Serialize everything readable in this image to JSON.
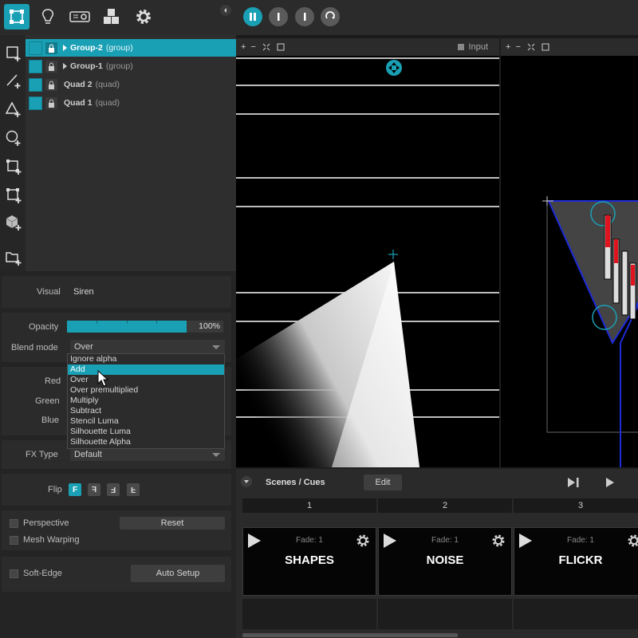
{
  "topbar": {
    "tools": [
      {
        "icon": "surface-tool-icon",
        "active": true
      },
      {
        "icon": "lightbulb-icon",
        "active": false
      },
      {
        "icon": "projector-icon",
        "active": false
      },
      {
        "icon": "cubes-icon",
        "active": false
      },
      {
        "icon": "gear-icon",
        "active": false
      }
    ],
    "transport": [
      {
        "icon": "pause-icon",
        "active": true
      },
      {
        "icon": "stop-icon",
        "active": false
      },
      {
        "icon": "stop-icon",
        "active": false
      },
      {
        "icon": "loop-icon",
        "active": false
      }
    ]
  },
  "layers": [
    {
      "name": "Group-2",
      "kind": "(group)",
      "selected": true
    },
    {
      "name": "Group-1",
      "kind": "(group)",
      "selected": false
    },
    {
      "name": "Quad 2",
      "kind": "(quad)",
      "selected": false
    },
    {
      "name": "Quad 1",
      "kind": "(quad)",
      "selected": false
    }
  ],
  "properties": {
    "visual_label": "Visual",
    "visual_value": "Siren",
    "opacity_label": "Opacity",
    "opacity_value": "100%",
    "opacity_level": 1.0,
    "blend_label": "Blend mode",
    "blend_value": "Over",
    "blend_options": [
      "Ignore alpha",
      "Add",
      "Over",
      "Over premultiplied",
      "Multiply",
      "Subtract",
      "Stencil Luma",
      "Silhouette Luma",
      "Silhouette Alpha"
    ],
    "blend_highlighted": "Add",
    "red_label": "Red",
    "green_label": "Green",
    "blue_label": "Blue",
    "fx_label": "FX Type",
    "fx_value": "Default",
    "flip_label": "Flip",
    "flip_buttons": [
      "F",
      "F",
      "F",
      "F"
    ],
    "perspective_label": "Perspective",
    "reset_label": "Reset",
    "mesh_label": "Mesh Warping",
    "softedge_label": "Soft-Edge",
    "autosetup_label": "Auto Setup"
  },
  "input_view": {
    "plus": "+",
    "minus": "−",
    "title": "Input"
  },
  "output_view": {
    "plus": "+",
    "minus": "−"
  },
  "scenes": {
    "title": "Scenes / Cues",
    "edit_label": "Edit",
    "columns": [
      "1",
      "2",
      "3"
    ],
    "cues": [
      {
        "fade": "Fade: 1",
        "name": "SHAPES"
      },
      {
        "fade": "Fade: 1",
        "name": "NOISE"
      },
      {
        "fade": "Fade: 1",
        "name": "FLICKR"
      }
    ]
  },
  "colors": {
    "accent": "#1aa0b5",
    "background": "#1e1e1e",
    "output_outline": "#1e2bd6",
    "red_bar": "#e0141e"
  }
}
